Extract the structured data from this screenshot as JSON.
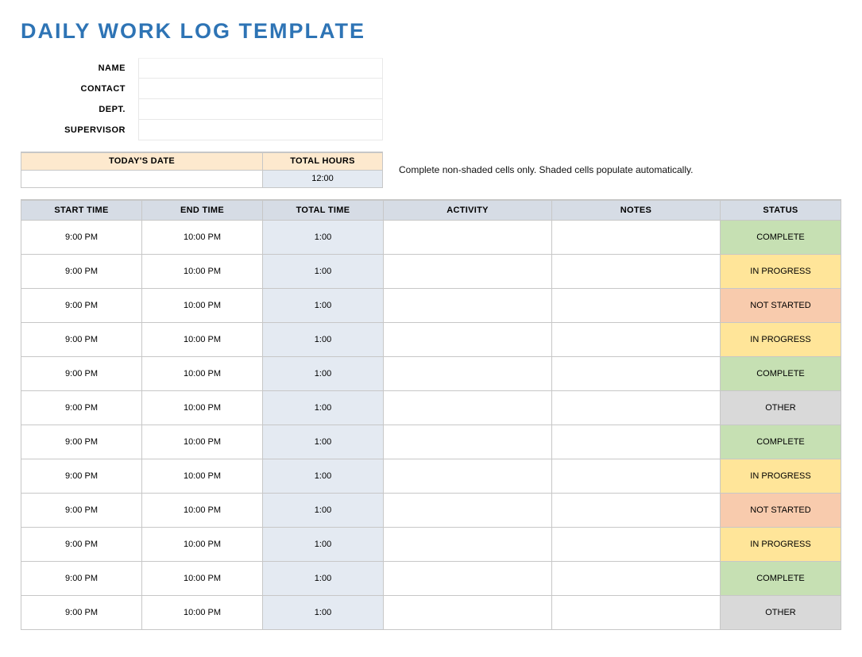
{
  "title": "DAILY WORK LOG TEMPLATE",
  "info": {
    "labels": {
      "name": "NAME",
      "contact": "CONTACT",
      "dept": "DEPT.",
      "supervisor": "SUPERVISOR"
    },
    "values": {
      "name": "",
      "contact": "",
      "dept": "",
      "supervisor": ""
    }
  },
  "summary": {
    "date_label": "TODAY'S DATE",
    "date_value": "",
    "hours_label": "TOTAL HOURS",
    "hours_value": "12:00"
  },
  "instructions": "Complete non-shaded cells only. Shaded cells populate automatically.",
  "columns": {
    "start": "START TIME",
    "end": "END TIME",
    "total": "TOTAL TIME",
    "activity": "ACTIVITY",
    "notes": "NOTES",
    "status": "STATUS"
  },
  "status_labels": {
    "complete": "COMPLETE",
    "in_progress": "IN PROGRESS",
    "not_started": "NOT STARTED",
    "other": "OTHER"
  },
  "rows": [
    {
      "start": "9:00 PM",
      "end": "10:00 PM",
      "total": "1:00",
      "activity": "",
      "notes": "",
      "status": "complete"
    },
    {
      "start": "9:00 PM",
      "end": "10:00 PM",
      "total": "1:00",
      "activity": "",
      "notes": "",
      "status": "in_progress"
    },
    {
      "start": "9:00 PM",
      "end": "10:00 PM",
      "total": "1:00",
      "activity": "",
      "notes": "",
      "status": "not_started"
    },
    {
      "start": "9:00 PM",
      "end": "10:00 PM",
      "total": "1:00",
      "activity": "",
      "notes": "",
      "status": "in_progress"
    },
    {
      "start": "9:00 PM",
      "end": "10:00 PM",
      "total": "1:00",
      "activity": "",
      "notes": "",
      "status": "complete"
    },
    {
      "start": "9:00 PM",
      "end": "10:00 PM",
      "total": "1:00",
      "activity": "",
      "notes": "",
      "status": "other"
    },
    {
      "start": "9:00 PM",
      "end": "10:00 PM",
      "total": "1:00",
      "activity": "",
      "notes": "",
      "status": "complete"
    },
    {
      "start": "9:00 PM",
      "end": "10:00 PM",
      "total": "1:00",
      "activity": "",
      "notes": "",
      "status": "in_progress"
    },
    {
      "start": "9:00 PM",
      "end": "10:00 PM",
      "total": "1:00",
      "activity": "",
      "notes": "",
      "status": "not_started"
    },
    {
      "start": "9:00 PM",
      "end": "10:00 PM",
      "total": "1:00",
      "activity": "",
      "notes": "",
      "status": "in_progress"
    },
    {
      "start": "9:00 PM",
      "end": "10:00 PM",
      "total": "1:00",
      "activity": "",
      "notes": "",
      "status": "complete"
    },
    {
      "start": "9:00 PM",
      "end": "10:00 PM",
      "total": "1:00",
      "activity": "",
      "notes": "",
      "status": "other"
    }
  ]
}
